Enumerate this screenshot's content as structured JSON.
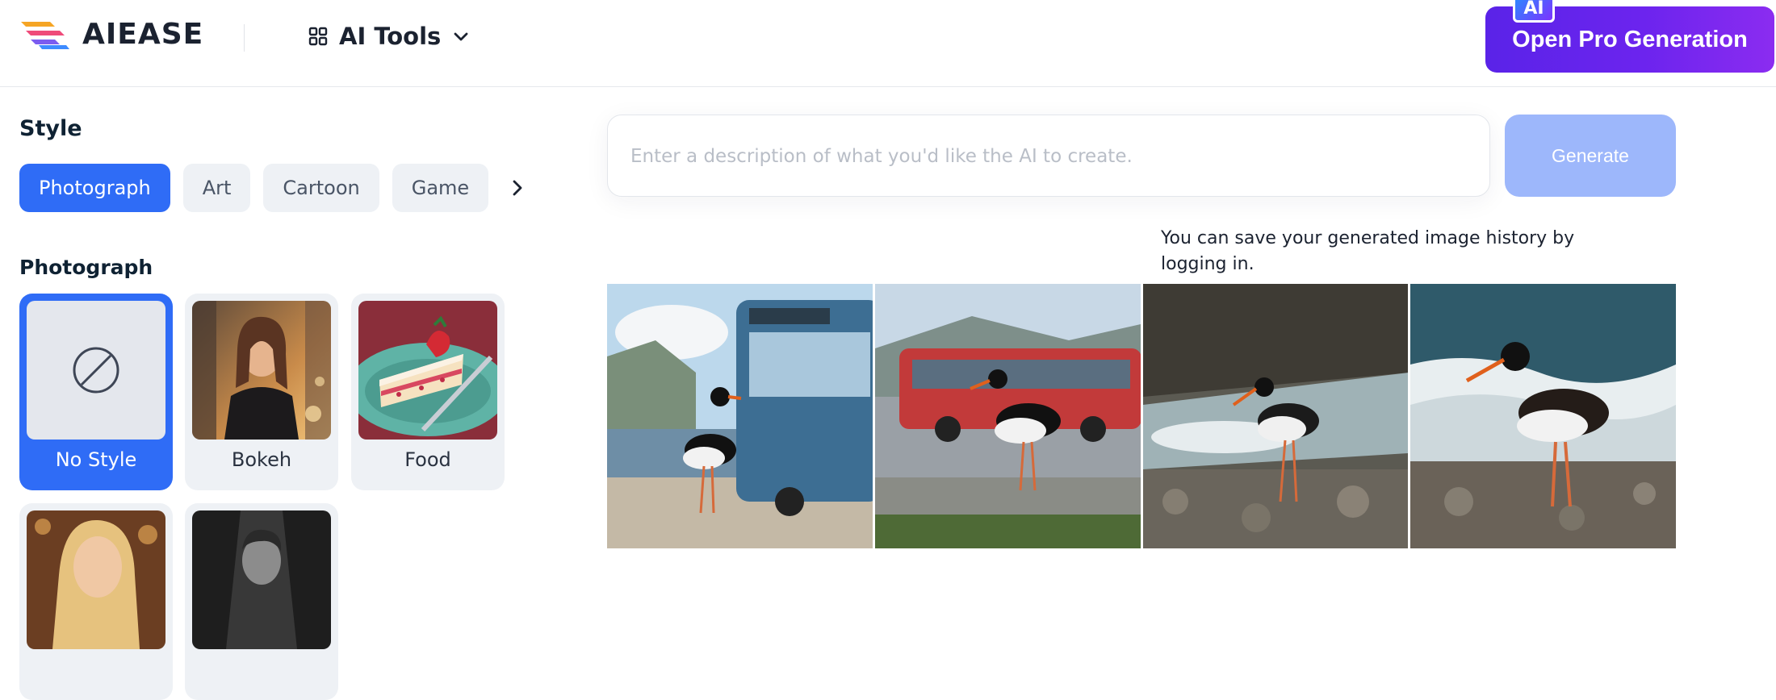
{
  "header": {
    "brand": "AIEASE",
    "tools_label": "AI Tools",
    "pro_button_label": "Open Pro Generation",
    "pro_badge": "AI"
  },
  "style_section": {
    "title": "Style",
    "tabs": [
      {
        "label": "Photograph",
        "active": true
      },
      {
        "label": "Art",
        "active": false
      },
      {
        "label": "Cartoon",
        "active": false
      },
      {
        "label": "Game",
        "active": false
      }
    ],
    "more_icon": "chevron-right-icon"
  },
  "photograph_section": {
    "title": "Photograph",
    "cards": [
      {
        "label": "No Style",
        "selected": true,
        "icon": "no-style-icon"
      },
      {
        "label": "Bokeh",
        "selected": false
      },
      {
        "label": "Food",
        "selected": false
      },
      {
        "label": "",
        "selected": false
      },
      {
        "label": "",
        "selected": false
      }
    ]
  },
  "prompt": {
    "placeholder": "Enter a description of what you'd like the AI to create.",
    "value": "",
    "generate_label": "Generate"
  },
  "history_note": "You can save your generated image history by logging in.",
  "results": [
    {
      "subject": "oystercatcher beside blue bus"
    },
    {
      "subject": "oystercatcher on street with red bus"
    },
    {
      "subject": "oystercatcher on rocky shore"
    },
    {
      "subject": "oystercatcher by waves"
    }
  ],
  "colors": {
    "accent": "#2f6cf6",
    "pro_gradient_start": "#5a23e8",
    "pro_gradient_end": "#8b2cf0",
    "generate_disabled": "#9db7fb"
  }
}
